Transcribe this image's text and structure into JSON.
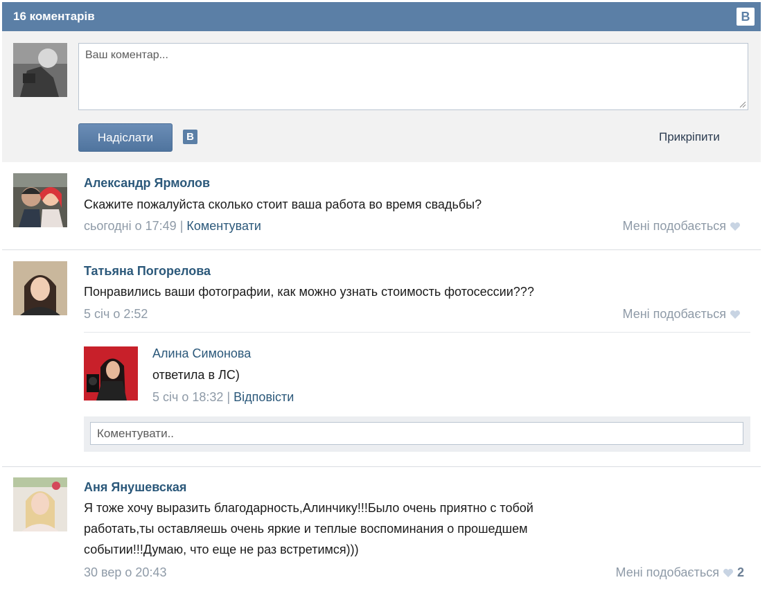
{
  "header": {
    "title": "16 коментарів",
    "logo": "В"
  },
  "composer": {
    "placeholder": "Ваш коментар...",
    "send_label": "Надіслати",
    "logo": "В",
    "attach_label": "Прикріпити"
  },
  "comments": [
    {
      "author": "Александр Ярмолов",
      "text": "Скажите пожалуйста сколько стоит ваша работа во время свадьбы?",
      "time": "сьогодні о 17:49",
      "sep": "|",
      "action": "Коментувати",
      "like_label": "Мені подобається"
    },
    {
      "author": "Татьяна Погорелова",
      "text": "Понравились ваши фотографии, как можно узнать стоимость фотосессии???",
      "time": "5 січ о 2:52",
      "like_label": "Мені подобається",
      "reply": {
        "author": "Алина Симонова",
        "text": "ответила в ЛС)",
        "time": "5 січ о 18:32",
        "sep": "|",
        "action": "Відповісти"
      },
      "reply_placeholder": "Коментувати.."
    },
    {
      "author": "Аня Янушевская",
      "text": "Я тоже хочу выразить благодарность,Алинчику!!!Было очень приятно с тобой\nработать,ты оставляешь очень яркие и теплые воспоминания о прошедшем\nсобытии!!!Думаю, что еще не раз встретимся)))",
      "time": "30 вер о 20:43",
      "like_label": "Мені подобається",
      "like_count": "2"
    }
  ],
  "colors": {
    "header": "#5b7fa6",
    "link": "#2b587a",
    "muted": "#8e9aa7",
    "heart": "#c8d4e3"
  }
}
